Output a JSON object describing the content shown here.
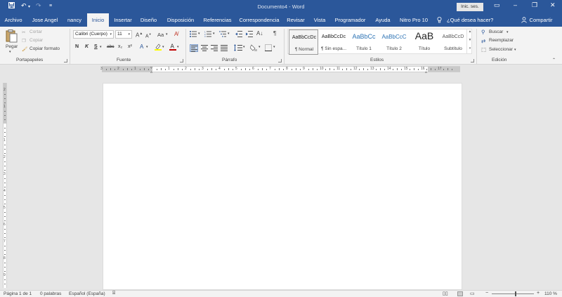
{
  "window": {
    "title": "Documento4 - Word",
    "sign_in": "Inic. ses."
  },
  "tabs": [
    {
      "label": "Archivo"
    },
    {
      "label": "Jose Angel"
    },
    {
      "label": "nancy"
    },
    {
      "label": "Inicio"
    },
    {
      "label": "Insertar"
    },
    {
      "label": "Diseño"
    },
    {
      "label": "Disposición"
    },
    {
      "label": "Referencias"
    },
    {
      "label": "Correspondencia"
    },
    {
      "label": "Revisar"
    },
    {
      "label": "Vista"
    },
    {
      "label": "Programador"
    },
    {
      "label": "Ayuda"
    },
    {
      "label": "Nitro Pro 10"
    }
  ],
  "tell_me": "¿Qué desea hacer?",
  "share": "Compartir",
  "clipboard": {
    "paste": "Pegar",
    "cut": "Cortar",
    "copy": "Copiar",
    "format_painter": "Copiar formato",
    "label": "Portapapeles"
  },
  "font": {
    "name": "Calibri (Cuerpo)",
    "size": "11",
    "change_case": "Aa",
    "bold": "N",
    "italic": "K",
    "underline": "S",
    "strike": "abc",
    "subscript": "x₂",
    "superscript": "x²",
    "label": "Fuente"
  },
  "paragraph": {
    "label": "Párrafo",
    "pilcrow": "¶"
  },
  "styles": {
    "label": "Estilos",
    "items": [
      {
        "preview": "AaBbCcDc",
        "name": "¶ Normal"
      },
      {
        "preview": "AaBbCcDc",
        "name": "¶ Sin espa..."
      },
      {
        "preview": "AaBbCc",
        "name": "Título 1"
      },
      {
        "preview": "AaBbCcC",
        "name": "Título 2"
      },
      {
        "preview": "AaB",
        "name": "Título"
      },
      {
        "preview": "AaBbCcD",
        "name": "Subtítulo"
      }
    ]
  },
  "editing": {
    "find": "Buscar",
    "replace": "Reemplazar",
    "select": "Seleccionar",
    "label": "Edición"
  },
  "ruler": {
    "numbers": [
      "3",
      "2",
      "1",
      "1",
      "2",
      "3",
      "4",
      "5",
      "6",
      "7",
      "8",
      "9",
      "10",
      "11",
      "12",
      "13",
      "14",
      "15",
      "16",
      "17"
    ],
    "vertical_numbers": [
      "2",
      "1",
      "1",
      "2",
      "3",
      "4",
      "5",
      "6",
      "7",
      "8",
      "9"
    ]
  },
  "status": {
    "page": "Página 1 de 1",
    "words": "0 palabras",
    "language": "Español (España)",
    "zoom": "110 %"
  },
  "colors": {
    "brand": "#2b579a",
    "highlight": "#ffff00",
    "font_color": "#c00000"
  }
}
